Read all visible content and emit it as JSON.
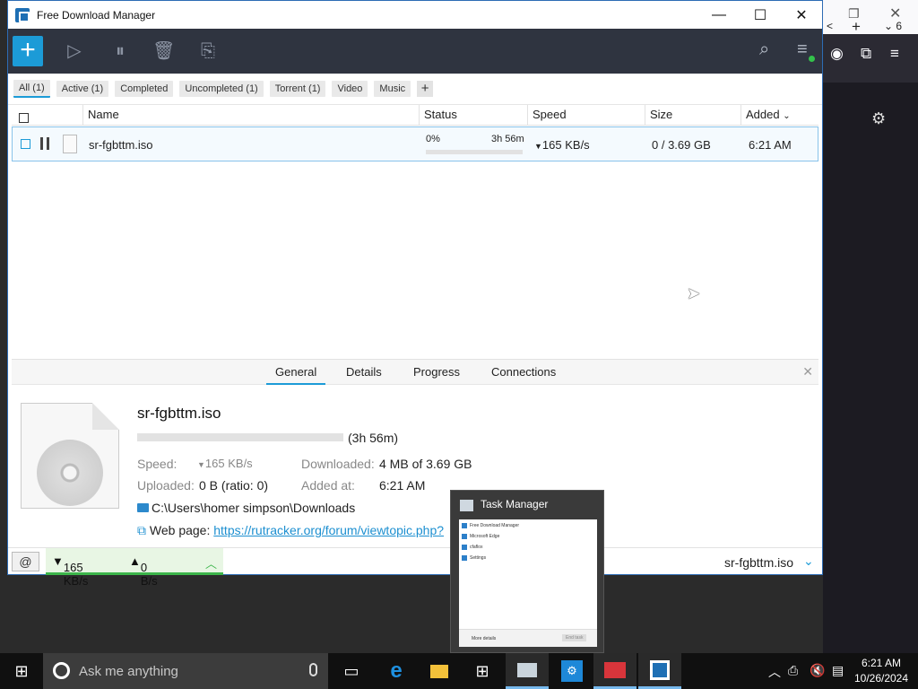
{
  "window": {
    "title": "Free Download Manager"
  },
  "filters": [
    "All (1)",
    "Active (1)",
    "Completed",
    "Uncompleted (1)",
    "Torrent (1)",
    "Video",
    "Music"
  ],
  "table": {
    "headers": {
      "name": "Name",
      "status": "Status",
      "speed": "Speed",
      "size": "Size",
      "added": "Added"
    },
    "rows": [
      {
        "name": "sr-fgbttm.iso",
        "status_percent": "0%",
        "time_left": "3h 56m",
        "progress": 0.0,
        "speed": "165 KB/s",
        "size": "0 / 3.69 GB",
        "added": "6:21 AM"
      }
    ]
  },
  "details": {
    "tabs": [
      "General",
      "Details",
      "Progress",
      "Connections"
    ],
    "active_tab": "General",
    "file_name": "sr-fgbttm.iso",
    "eta": "(3h 56m)",
    "speed_label": "Speed:",
    "speed_value": "165 KB/s",
    "downloaded_label": "Downloaded:",
    "downloaded_value": "4 MB of 3.69 GB",
    "uploaded_label": "Uploaded:",
    "uploaded_value": "0 B (ratio: 0)",
    "added_label": "Added at:",
    "added_value": "6:21 AM",
    "path": "C:\\Users\\homer simpson\\Downloads",
    "web_label": "Web page:",
    "web_url": "https://rutracker.org/forum/viewtopic.php?"
  },
  "statusbar": {
    "down": "165 KB/s",
    "up": "0 B/s",
    "current": "sr-fgbttm.iso"
  },
  "taskmanager": {
    "title": "Task Manager",
    "items": [
      "Free Download Manager",
      "Microsoft Edge",
      "cfaflox",
      "Settings"
    ],
    "footer": "More details",
    "end_task": "End task"
  },
  "taskbar": {
    "search_placeholder": "Ask me anything",
    "time": "6:21 AM",
    "date": "10/26/2024"
  },
  "browser": {
    "tab_count": "6"
  },
  "colors": {
    "accent": "#1c9bd7",
    "toolbar": "#2f3440",
    "progress": "#3cb54a"
  }
}
